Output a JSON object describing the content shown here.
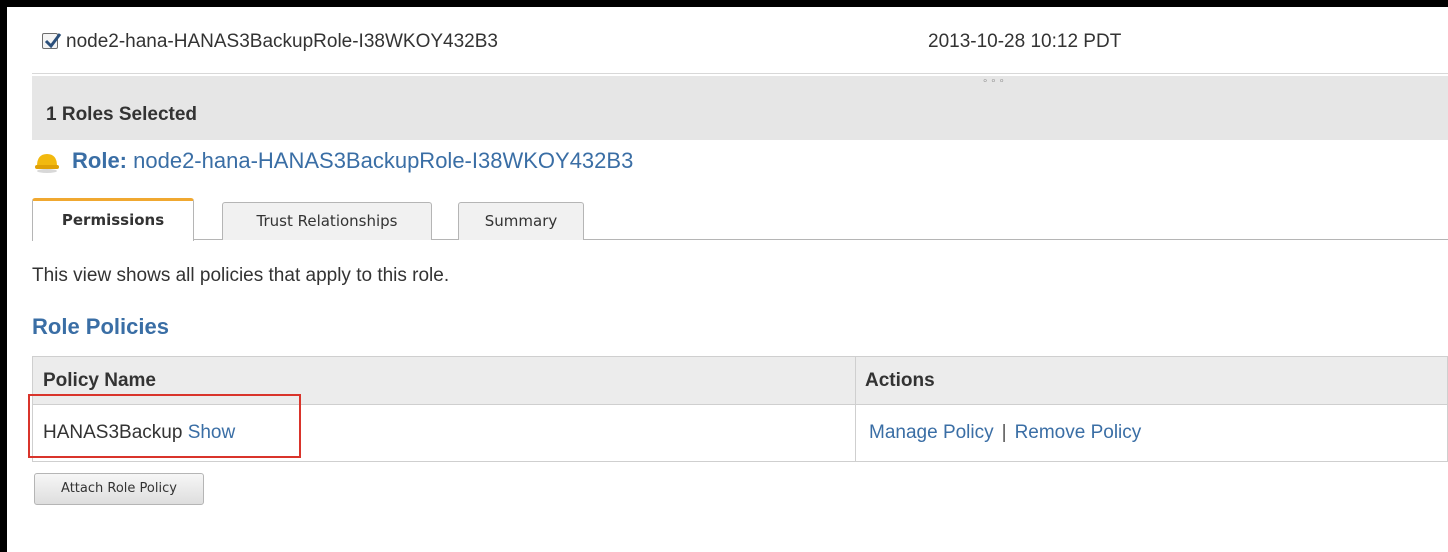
{
  "role_row": {
    "checked": true,
    "name": "node2-hana-HANAS3BackupRole-I38WKOY432B3",
    "created": "2013-10-28 10:12 PDT"
  },
  "drag_handle": {
    "icon": "grip-dots-icon"
  },
  "selection": {
    "text": "1 Roles Selected"
  },
  "role_header": {
    "icon": "role-hardhat-icon",
    "label": "Role:",
    "name": "node2-hana-HANAS3BackupRole-I38WKOY432B3"
  },
  "tabs": [
    {
      "label": "Permissions",
      "active": true
    },
    {
      "label": "Trust Relationships",
      "active": false
    },
    {
      "label": "Summary",
      "active": false
    }
  ],
  "description": "This view shows all policies that apply to this role.",
  "section_title": "Role Policies",
  "table": {
    "headers": {
      "policy_name": "Policy Name",
      "actions": "Actions"
    },
    "rows": [
      {
        "policy_name": "HANAS3Backup",
        "show_link": "Show",
        "actions": {
          "manage": "Manage Policy",
          "separator": "|",
          "remove": "Remove Policy"
        }
      }
    ]
  },
  "buttons": {
    "attach": "Attach Role Policy"
  },
  "colors": {
    "link": "#3a6ea5",
    "active_tab_accent": "#f0a830",
    "highlight": "#d9342b",
    "header_bg": "#e6e6e6"
  }
}
